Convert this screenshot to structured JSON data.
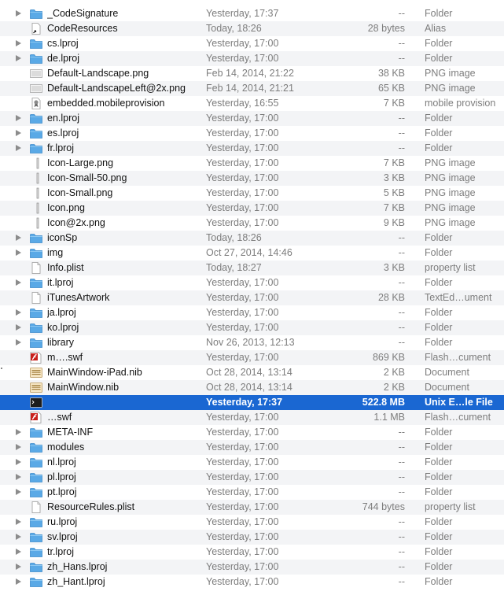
{
  "files": [
    {
      "name": "_CodeSignature",
      "date": "Yesterday, 17:37",
      "size": "--",
      "kind": "Folder",
      "icon": "folder-icon",
      "expandable": true
    },
    {
      "name": "CodeResources",
      "date": "Today, 18:26",
      "size": "28 bytes",
      "kind": "Alias",
      "icon": "alias-icon",
      "expandable": false
    },
    {
      "name": "cs.lproj",
      "date": "Yesterday, 17:00",
      "size": "--",
      "kind": "Folder",
      "icon": "folder-icon",
      "expandable": true
    },
    {
      "name": "de.lproj",
      "date": "Yesterday, 17:00",
      "size": "--",
      "kind": "Folder",
      "icon": "folder-icon",
      "expandable": true
    },
    {
      "name": "Default-Landscape.png",
      "date": "Feb 14, 2014, 21:22",
      "size": "38 KB",
      "kind": "PNG image",
      "icon": "image-file-icon",
      "expandable": false
    },
    {
      "name": "Default-LandscapeLeft@2x.png",
      "date": "Feb 14, 2014, 21:21",
      "size": "65 KB",
      "kind": "PNG image",
      "icon": "image-file-icon",
      "expandable": false
    },
    {
      "name": "embedded.mobileprovision",
      "date": "Yesterday, 16:55",
      "size": "7 KB",
      "kind": "mobile provision",
      "icon": "certificate-file-icon",
      "expandable": false
    },
    {
      "name": "en.lproj",
      "date": "Yesterday, 17:00",
      "size": "--",
      "kind": "Folder",
      "icon": "folder-icon",
      "expandable": true
    },
    {
      "name": "es.lproj",
      "date": "Yesterday, 17:00",
      "size": "--",
      "kind": "Folder",
      "icon": "folder-icon",
      "expandable": true
    },
    {
      "name": "fr.lproj",
      "date": "Yesterday, 17:00",
      "size": "--",
      "kind": "Folder",
      "icon": "folder-icon",
      "expandable": true
    },
    {
      "name": "Icon-Large.png",
      "date": "Yesterday, 17:00",
      "size": "7 KB",
      "kind": "PNG image",
      "icon": "thin-image-icon",
      "expandable": false
    },
    {
      "name": "Icon-Small-50.png",
      "date": "Yesterday, 17:00",
      "size": "3 KB",
      "kind": "PNG image",
      "icon": "thin-image-icon",
      "expandable": false
    },
    {
      "name": "Icon-Small.png",
      "date": "Yesterday, 17:00",
      "size": "5 KB",
      "kind": "PNG image",
      "icon": "thin-image-icon",
      "expandable": false
    },
    {
      "name": "Icon.png",
      "date": "Yesterday, 17:00",
      "size": "7 KB",
      "kind": "PNG image",
      "icon": "thin-image-icon",
      "expandable": false
    },
    {
      "name": "Icon@2x.png",
      "date": "Yesterday, 17:00",
      "size": "9 KB",
      "kind": "PNG image",
      "icon": "thin-image-icon",
      "expandable": false
    },
    {
      "name": "iconSp",
      "date": "Today, 18:26",
      "size": "--",
      "kind": "Folder",
      "icon": "folder-icon",
      "expandable": true
    },
    {
      "name": "img",
      "date": "Oct 27, 2014, 14:46",
      "size": "--",
      "kind": "Folder",
      "icon": "folder-icon",
      "expandable": true
    },
    {
      "name": "Info.plist",
      "date": "Today, 18:27",
      "size": "3 KB",
      "kind": "property list",
      "icon": "document-icon",
      "expandable": false
    },
    {
      "name": "it.lproj",
      "date": "Yesterday, 17:00",
      "size": "--",
      "kind": "Folder",
      "icon": "folder-icon",
      "expandable": true
    },
    {
      "name": "iTunesArtwork",
      "date": "Yesterday, 17:00",
      "size": "28 KB",
      "kind": "TextEd…ument",
      "icon": "document-icon",
      "expandable": false
    },
    {
      "name": "ja.lproj",
      "date": "Yesterday, 17:00",
      "size": "--",
      "kind": "Folder",
      "icon": "folder-icon",
      "expandable": true
    },
    {
      "name": "ko.lproj",
      "date": "Yesterday, 17:00",
      "size": "--",
      "kind": "Folder",
      "icon": "folder-icon",
      "expandable": true
    },
    {
      "name": "library",
      "date": "Nov 26, 2013, 12:13",
      "size": "--",
      "kind": "Folder",
      "icon": "folder-icon",
      "expandable": true
    },
    {
      "name": "m….swf",
      "date": "Yesterday, 17:00",
      "size": "869 KB",
      "kind": "Flash…cument",
      "icon": "flash-file-icon",
      "expandable": false
    },
    {
      "name": "MainWindow-iPad.nib",
      "date": "Oct 28, 2014, 13:14",
      "size": "2 KB",
      "kind": "Document",
      "icon": "nib-file-icon",
      "expandable": false
    },
    {
      "name": "MainWindow.nib",
      "date": "Oct 28, 2014, 13:14",
      "size": "2 KB",
      "kind": "Document",
      "icon": "nib-file-icon",
      "expandable": false
    },
    {
      "name": "",
      "date": "Yesterday, 17:37",
      "size": "522.8 MB",
      "kind": "Unix E…le File",
      "icon": "terminal-exec-icon",
      "expandable": false,
      "selected": true
    },
    {
      "name": "…swf",
      "date": "Yesterday, 17:00",
      "size": "1.1 MB",
      "kind": "Flash…cument",
      "icon": "flash-file-icon",
      "expandable": false
    },
    {
      "name": "META-INF",
      "date": "Yesterday, 17:00",
      "size": "--",
      "kind": "Folder",
      "icon": "folder-icon",
      "expandable": true
    },
    {
      "name": "modules",
      "date": "Yesterday, 17:00",
      "size": "--",
      "kind": "Folder",
      "icon": "folder-icon",
      "expandable": true
    },
    {
      "name": "nl.lproj",
      "date": "Yesterday, 17:00",
      "size": "--",
      "kind": "Folder",
      "icon": "folder-icon",
      "expandable": true
    },
    {
      "name": "pl.lproj",
      "date": "Yesterday, 17:00",
      "size": "--",
      "kind": "Folder",
      "icon": "folder-icon",
      "expandable": true
    },
    {
      "name": "pt.lproj",
      "date": "Yesterday, 17:00",
      "size": "--",
      "kind": "Folder",
      "icon": "folder-icon",
      "expandable": true
    },
    {
      "name": "ResourceRules.plist",
      "date": "Yesterday, 17:00",
      "size": "744 bytes",
      "kind": "property list",
      "icon": "document-icon",
      "expandable": false
    },
    {
      "name": "ru.lproj",
      "date": "Yesterday, 17:00",
      "size": "--",
      "kind": "Folder",
      "icon": "folder-icon",
      "expandable": true
    },
    {
      "name": "sv.lproj",
      "date": "Yesterday, 17:00",
      "size": "--",
      "kind": "Folder",
      "icon": "folder-icon",
      "expandable": true
    },
    {
      "name": "tr.lproj",
      "date": "Yesterday, 17:00",
      "size": "--",
      "kind": "Folder",
      "icon": "folder-icon",
      "expandable": true
    },
    {
      "name": "zh_Hans.lproj",
      "date": "Yesterday, 17:00",
      "size": "--",
      "kind": "Folder",
      "icon": "folder-icon",
      "expandable": true
    },
    {
      "name": "zh_Hant.lproj",
      "date": "Yesterday, 17:00",
      "size": "--",
      "kind": "Folder",
      "icon": "folder-icon",
      "expandable": true
    }
  ],
  "colors": {
    "selection": "#1a67d2",
    "folder": "#5aa9e6",
    "alt_row": "#f3f4f6",
    "secondary_text": "#7d7d7d"
  }
}
